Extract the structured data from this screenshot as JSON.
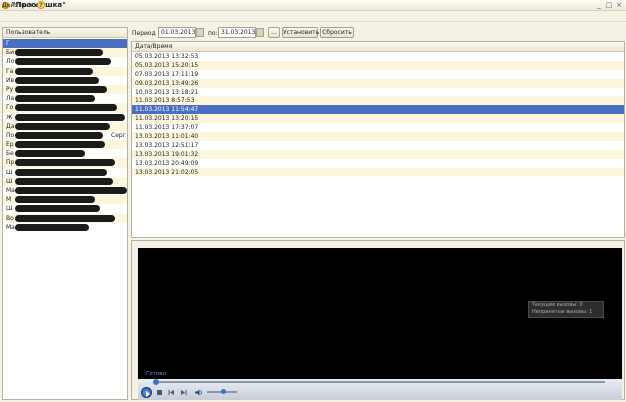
{
  "window": {
    "title": "\"Прослушка\"",
    "controls": [
      "_",
      "□",
      "×"
    ]
  },
  "menu": {
    "actions_label": "Действия ▾",
    "help_glyph": "?"
  },
  "users": {
    "header": "Пользователь",
    "items": [
      {
        "text": "Г",
        "selected": true
      },
      {
        "text": "Би"
      },
      {
        "text": "Ло"
      },
      {
        "text": "Га"
      },
      {
        "text": "Ив"
      },
      {
        "text": "Ру"
      },
      {
        "text": "Ла"
      },
      {
        "text": "Го"
      },
      {
        "text": "Ж"
      },
      {
        "text": "Да"
      },
      {
        "text": "По",
        "tail": "Серг"
      },
      {
        "text": "Ер"
      },
      {
        "text": "Бе"
      },
      {
        "text": "Пр"
      },
      {
        "text": "Ш"
      },
      {
        "text": "Ш"
      },
      {
        "text": "Ма"
      },
      {
        "text": "М"
      },
      {
        "text": "Ш"
      },
      {
        "text": "Во"
      },
      {
        "text": "Ма"
      }
    ]
  },
  "toolbar": {
    "period_from_label": "Период с:",
    "date_from": "01.03.2013",
    "period_to_label": "по:",
    "date_to": "31.03.2013",
    "ellipsis_label": "...",
    "set_label": "Установить",
    "reset_label": "Сбросить"
  },
  "grid": {
    "header": "Дата/Время",
    "selected_index": 6,
    "rows": [
      "05.03.2013 13:32:53",
      "05.03.2013 15:20:15",
      "07.03.2013 17:11:19",
      "09.03.2013 13:49:26",
      "10.03.2013 13:18:21",
      "11.03.2013 8:57:53",
      "11.03.2013 11:54:47",
      "11.03.2013 13:20:15",
      "11.03.2013 17:37:07",
      "13.03.2013 11:01:40",
      "13.03.2013 12:51:17",
      "13.03.2013 19:01:32",
      "13.03.2013 20:49:09",
      "13.03.2013 21:02:05"
    ]
  },
  "player": {
    "status": "Готово",
    "toast_line1": "Текущие вызовы: 0",
    "toast_line2": "Непринятые вызовы: 1"
  }
}
